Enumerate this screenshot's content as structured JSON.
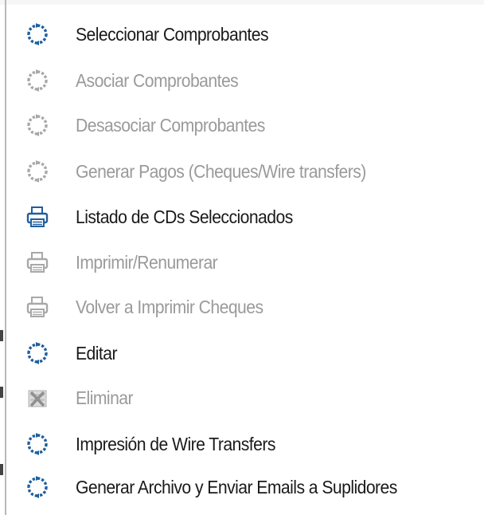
{
  "menu": {
    "items": [
      {
        "label": "Seleccionar Comprobantes",
        "icon": "refresh-icon",
        "enabled": true
      },
      {
        "label": "Asociar Comprobantes",
        "icon": "refresh-icon",
        "enabled": false
      },
      {
        "label": "Desasociar Comprobantes",
        "icon": "refresh-icon",
        "enabled": false
      },
      {
        "label": "Generar Pagos (Cheques/Wire transfers)",
        "icon": "refresh-icon",
        "enabled": false
      },
      {
        "label": "Listado de CDs Seleccionados",
        "icon": "printer-icon",
        "enabled": true
      },
      {
        "label": "Imprimir/Renumerar",
        "icon": "printer-icon",
        "enabled": false
      },
      {
        "label": "Volver a Imprimir Cheques",
        "icon": "printer-icon",
        "enabled": false
      },
      {
        "label": "Editar",
        "icon": "refresh-icon",
        "enabled": true
      },
      {
        "label": "Eliminar",
        "icon": "delete-icon",
        "enabled": false
      },
      {
        "label": "Impresión de Wire Transfers",
        "icon": "refresh-icon",
        "enabled": true
      },
      {
        "label": "Generar Archivo y Enviar Emails a Suplidores",
        "icon": "refresh-icon",
        "enabled": true
      }
    ]
  },
  "colors": {
    "icon_blue": "#1f5f9e",
    "icon_disabled": "#a8a8a8",
    "text_enabled": "#1a1a1a",
    "text_disabled": "#9a9a9a"
  }
}
